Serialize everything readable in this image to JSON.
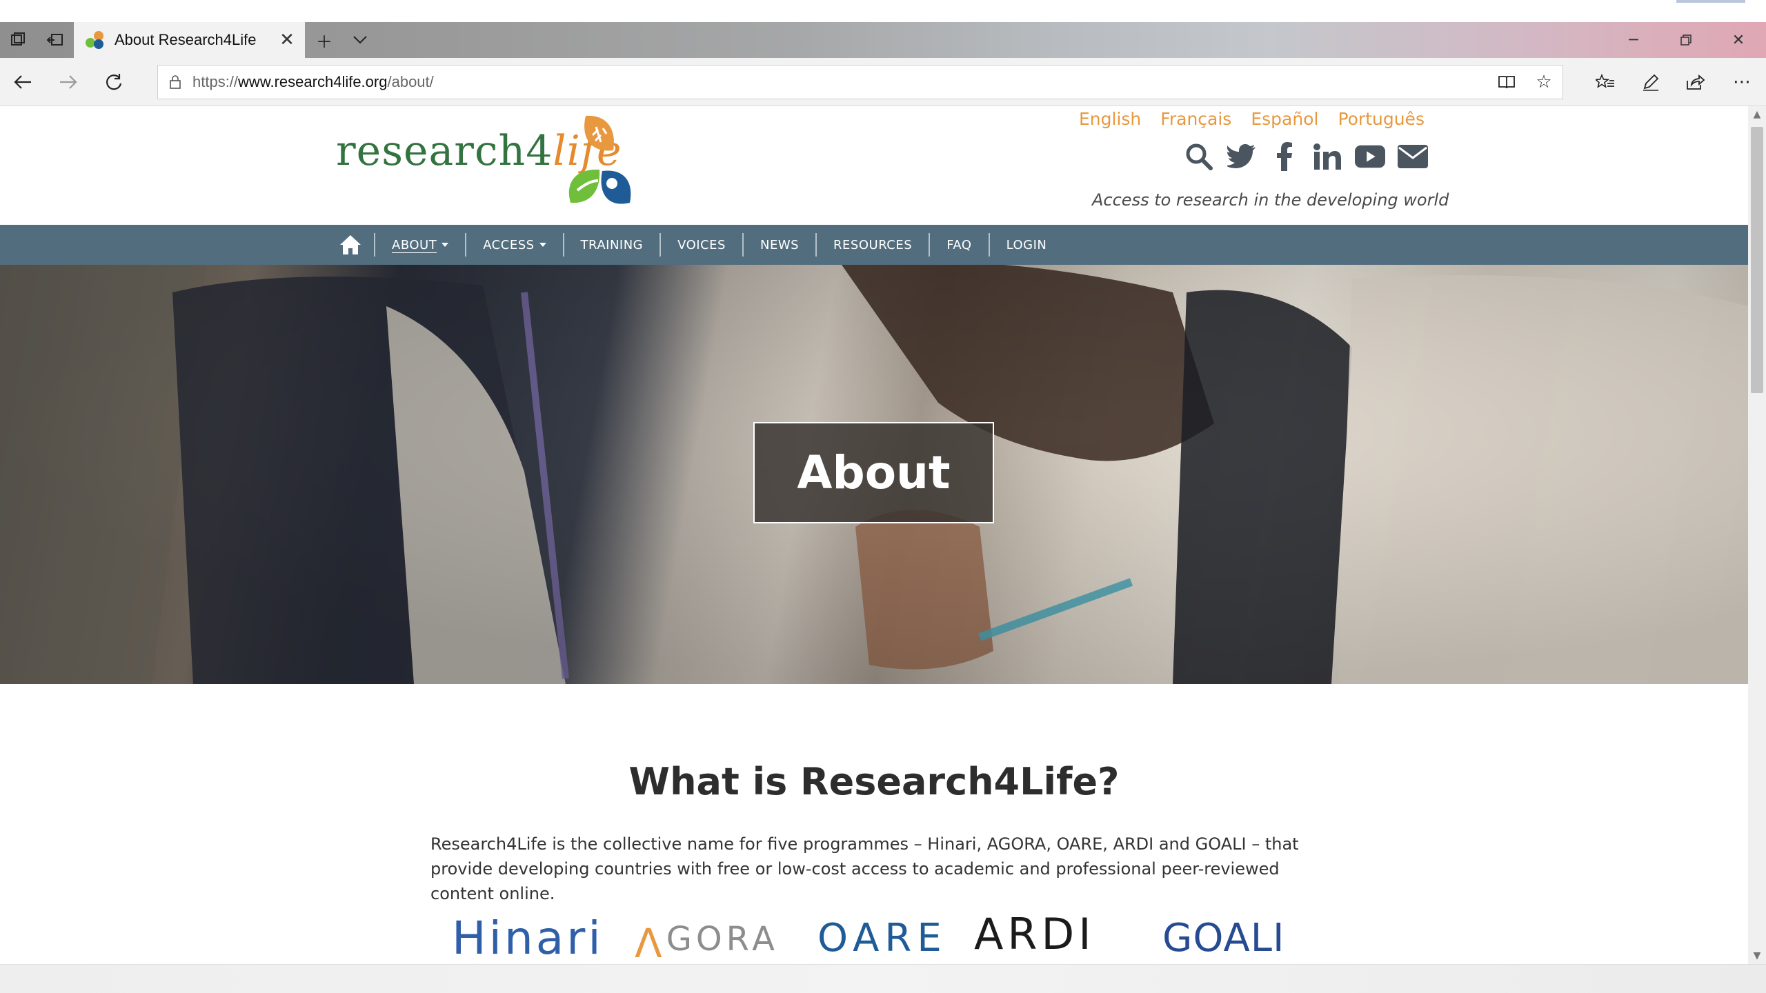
{
  "browser": {
    "tab_title": "About Research4Life",
    "url_prefix": "https://",
    "url_host": "www.research4life.org",
    "url_path": "/about/"
  },
  "site": {
    "logo_text_main": "research4",
    "logo_text_life": "life",
    "languages": [
      "English",
      "Français",
      "Español",
      "Português"
    ],
    "social_icons": [
      "search-icon",
      "twitter-icon",
      "facebook-icon",
      "linkedin-icon",
      "youtube-icon",
      "mail-icon"
    ],
    "tagline": "Access to research in the developing world",
    "accent_color": "#e8983e",
    "nav_color": "#526d7e"
  },
  "nav": {
    "items": [
      {
        "label": "ABOUT",
        "dropdown": true,
        "active": true
      },
      {
        "label": "ACCESS",
        "dropdown": true
      },
      {
        "label": "TRAINING"
      },
      {
        "label": "VOICES"
      },
      {
        "label": "NEWS"
      },
      {
        "label": "RESOURCES"
      },
      {
        "label": "FAQ"
      },
      {
        "label": "LOGIN"
      }
    ]
  },
  "hero": {
    "title": "About"
  },
  "content": {
    "heading": "What is Research4Life?",
    "text": "Research4Life is the collective name for five programmes – Hinari, AGORA, OARE, ARDI and GOALI – that provide developing countries with free or low-cost access to academic and professional peer-reviewed content online."
  },
  "programs": {
    "hinari": "Hinari",
    "agora": "GORA",
    "oare": "OARE",
    "ardi": "ARDI",
    "goali": "GOALI"
  }
}
